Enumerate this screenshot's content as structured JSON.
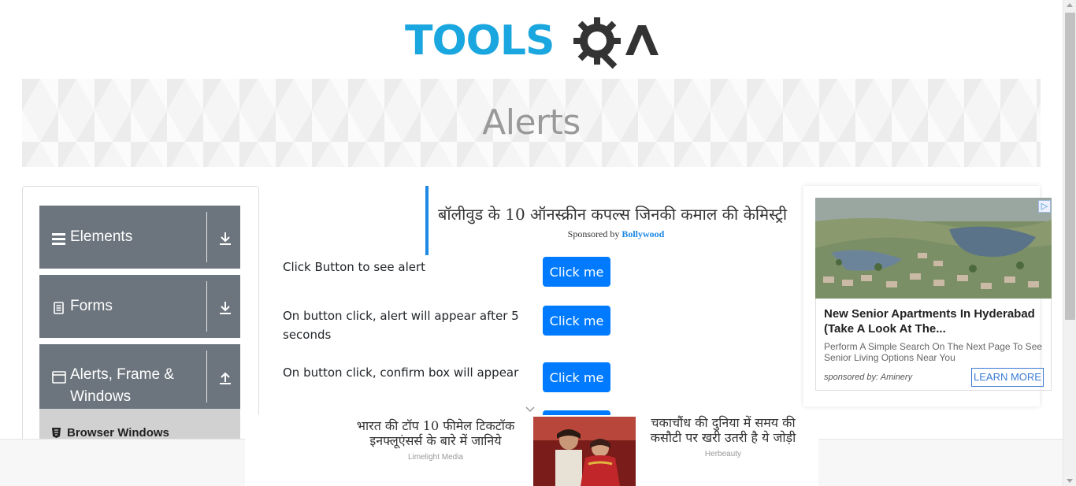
{
  "header": {
    "logo_text": "TOOLS",
    "logo_suffix": "QA",
    "page_title": "Alerts"
  },
  "sidebar": {
    "groups": [
      {
        "label": "Elements",
        "icon": "menu-icon",
        "arrow": "download-icon"
      },
      {
        "label": "Forms",
        "icon": "document-icon",
        "arrow": "download-icon"
      },
      {
        "label": "Alerts, Frame & Windows",
        "icon": "window-icon",
        "arrow": "upload-icon"
      }
    ],
    "active_subitem": "Browser Windows"
  },
  "sponsored": {
    "headline": "बॉलीवुड के 10 ऑनस्क्रीन कपल्स जिनकी कमाल की केमिस्ट्री",
    "by_prefix": "Sponsored by",
    "by_name": "Bollywood"
  },
  "alerts": [
    {
      "label": "Click Button to see alert",
      "button": "Click me"
    },
    {
      "label": "On button click, alert will appear after 5 seconds",
      "button": "Click me"
    },
    {
      "label": "On button click, confirm box will appear",
      "button": "Click me"
    }
  ],
  "ad_right": {
    "title": "New Senior Apartments In Hyderabad (Take A Look At The...",
    "description": "Perform A Simple Search On The Next Page To See Senior Living Options Near You",
    "sponsor": "sponsored by: Aminery",
    "cta": "LEARN MORE"
  },
  "bottom_ad": {
    "left_title": "भारत की टॉप 10 फीमेल टिकटॉक इनफ्लूएंसर्स के बारे में जानिये",
    "left_source": "Limelight Media",
    "right_title": "चकाचौंध की दुनिया में समय की कसौटी पर खरी उतरी है ये जोड़ी",
    "right_source": "Herbeauty"
  },
  "colors": {
    "brand_blue": "#1aa6de",
    "button_blue": "#007bff",
    "sidebar_gray": "#6c757d"
  }
}
